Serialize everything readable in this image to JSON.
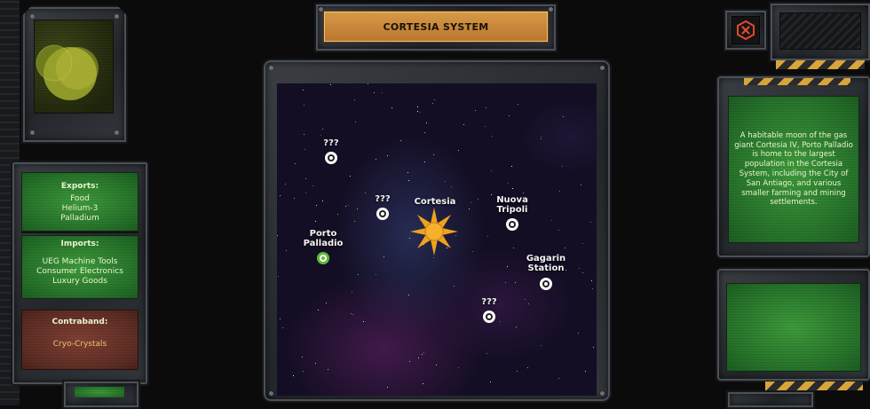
{
  "header": {
    "title": "CORTESIA SYSTEM"
  },
  "trade": {
    "exports_title": "Exports:",
    "exports": [
      "Food",
      "Helium-3",
      "Palladium"
    ],
    "imports_title": "Imports:",
    "imports": [
      "UEG Machine Tools",
      "Consumer Electronics",
      "Luxury Goods"
    ],
    "contraband_title": "Contraband:",
    "contraband": [
      "Cryo-Crystals"
    ]
  },
  "map": {
    "star_label": "Cortesia",
    "locations": [
      {
        "label": "???"
      },
      {
        "label": "???"
      },
      {
        "label": "Porto Palladio"
      },
      {
        "label": "Nuova Tripoli"
      },
      {
        "label": "Gagarin Station"
      },
      {
        "label": "???"
      }
    ]
  },
  "info": {
    "description": "A habitable moon of the gas giant Cortesia IV, Porto Palladio is home to the largest population in the Cortesia System, including the City of San Antiago, and various smaller farming and mining settlements."
  },
  "colors": {
    "accent": "#d79a46",
    "screen_green": "#2e8a33",
    "screen_red": "#5b2c24",
    "close": "#e04a2c"
  },
  "icons": {
    "close": "close-hex-icon",
    "planet": "planet-icon",
    "sun": "sun-icon"
  }
}
